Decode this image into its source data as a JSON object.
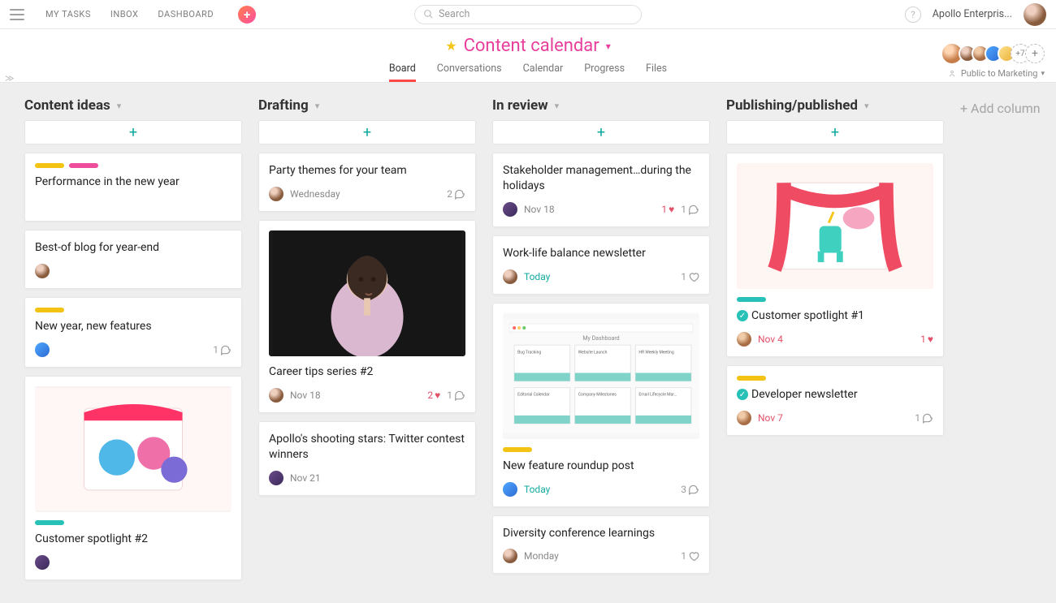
{
  "topnav": {
    "my_tasks": "MY TASKS",
    "inbox": "INBOX",
    "dashboard": "DASHBOARD"
  },
  "search": {
    "placeholder": "Search"
  },
  "workspace": {
    "name": "Apollo Enterpris..."
  },
  "project": {
    "title": "Content calendar",
    "tabs": {
      "board": "Board",
      "conversations": "Conversations",
      "calendar": "Calendar",
      "progress": "Progress",
      "files": "Files"
    },
    "privacy": "Public to Marketing",
    "member_more": "+7"
  },
  "board": {
    "add_column": "+ Add column",
    "columns": [
      {
        "title": "Content ideas",
        "cards": [
          {
            "tags": [
              "yellow",
              "pink"
            ],
            "title": "Performance in the new year"
          },
          {
            "title": "Best-of blog for year-end",
            "assignee": "avB"
          },
          {
            "tags": [
              "yellow"
            ],
            "title": "New year, new features",
            "assignee": "avD",
            "comments": "1"
          },
          {
            "image": "unicorns",
            "tags_below": [
              "teal"
            ],
            "title": "Customer spotlight #2",
            "assignee": "avC"
          }
        ]
      },
      {
        "title": "Drafting",
        "cards": [
          {
            "title": "Party themes for your team",
            "assignee": "avB",
            "date": "Wednesday",
            "comments": "2"
          },
          {
            "image": "woman",
            "title": "Career tips series #2",
            "assignee": "avB",
            "date": "Nov 18",
            "likes": "2",
            "comments": "1"
          },
          {
            "title": "Apollo's shooting stars: Twitter contest winners",
            "assignee": "avC",
            "date": "Nov 21"
          }
        ]
      },
      {
        "title": "In review",
        "cards": [
          {
            "title": "Stakeholder management…during the holidays",
            "assignee": "avC",
            "date": "Nov 18",
            "likes": "1",
            "comments": "1"
          },
          {
            "title": "Work-life balance newsletter",
            "assignee": "avB",
            "date": "Today",
            "date_class": "today",
            "comments_outline": "1"
          },
          {
            "image": "dashboard",
            "tags_below": [
              "yellow"
            ],
            "title": "New feature roundup post",
            "assignee": "avD",
            "date": "Today",
            "date_class": "today",
            "comments": "3"
          },
          {
            "title": "Diversity conference learnings",
            "assignee": "avB",
            "date": "Monday",
            "comments_outline": "1"
          }
        ]
      },
      {
        "title": "Publishing/published",
        "cards": [
          {
            "image": "stage",
            "tags_below": [
              "teal"
            ],
            "title": "Customer spotlight #1",
            "completed": true,
            "assignee": "avF",
            "date": "Nov 4",
            "date_class": "red",
            "likes": "1"
          },
          {
            "tags": [
              "yellow"
            ],
            "title": "Developer newsletter",
            "completed": true,
            "assignee": "avF",
            "date": "Nov 7",
            "date_class": "red",
            "comments": "1"
          }
        ]
      }
    ]
  }
}
